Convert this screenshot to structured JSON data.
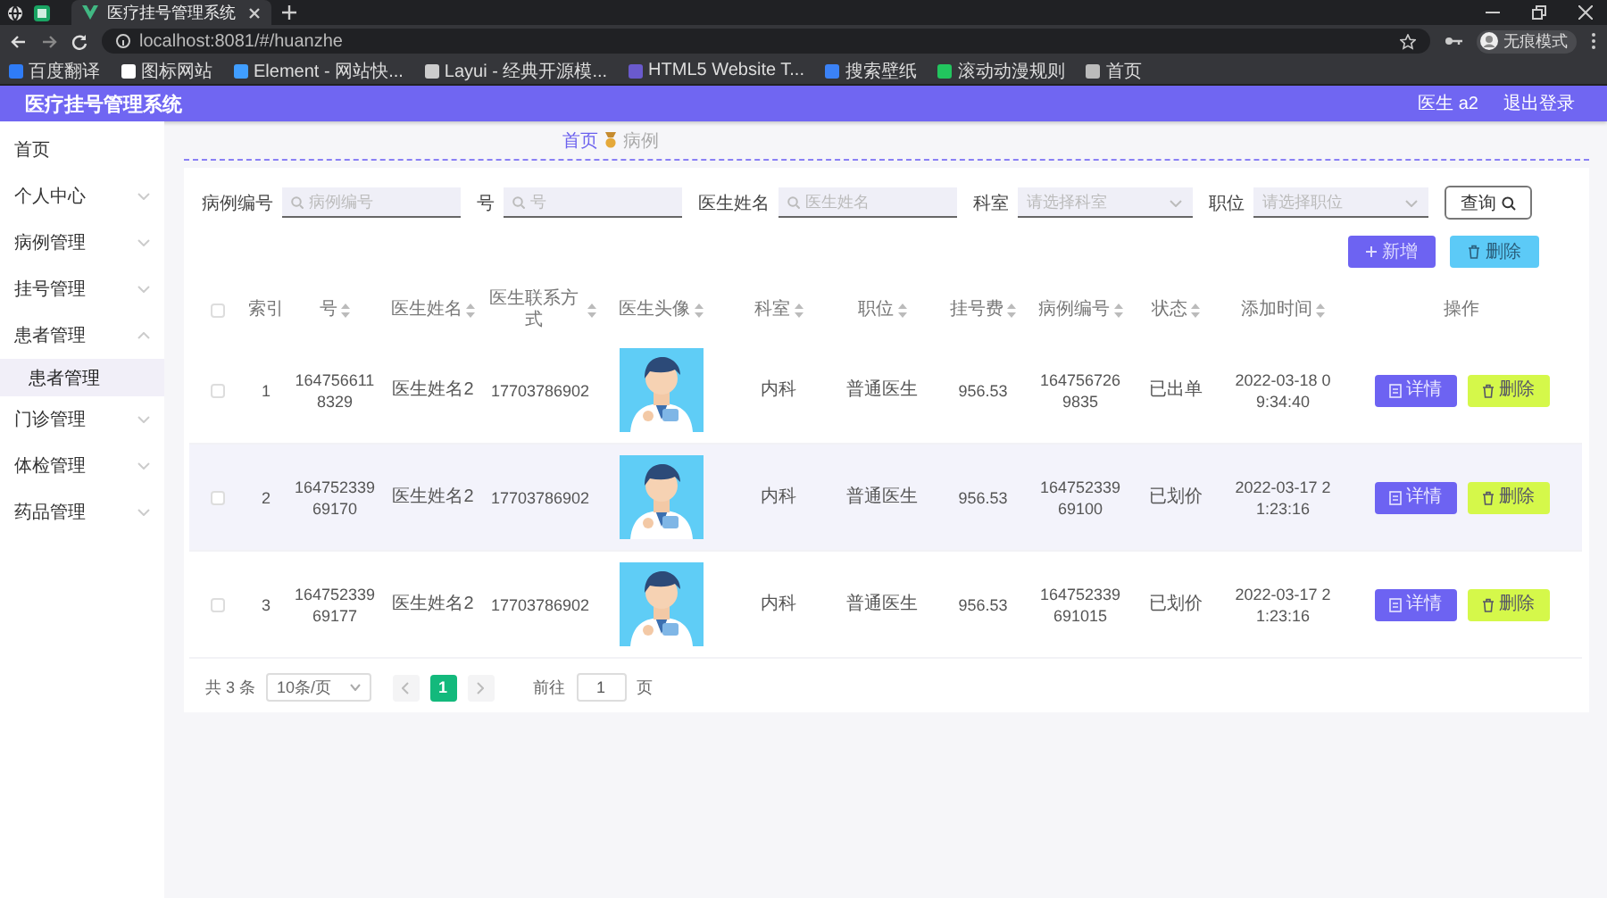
{
  "browser": {
    "tab_title": "医疗挂号管理系统",
    "url": "localhost:8081/#/huanzhe",
    "profile": "无痕模式",
    "bookmarks": [
      {
        "label": "百度翻译",
        "color": "#2f7cf6"
      },
      {
        "label": "图标网站",
        "color": "#ffffff"
      },
      {
        "label": "Element - 网站快...",
        "color": "#409eff"
      },
      {
        "label": "Layui - 经典开源模...",
        "color": "#cccccc"
      },
      {
        "label": "HTML5 Website T...",
        "color": "#6a5acd"
      },
      {
        "label": "搜索壁纸",
        "color": "#3b82f6"
      },
      {
        "label": "滚动动漫规则",
        "color": "#22c55e"
      },
      {
        "label": "首页",
        "color": "#bbbbbb"
      }
    ]
  },
  "app": {
    "title": "医疗挂号管理系统",
    "user": "医生 a2",
    "logout": "退出登录"
  },
  "sidebar": [
    {
      "label": "首页",
      "kind": "link"
    },
    {
      "label": "个人中心",
      "kind": "submenu",
      "expanded": false
    },
    {
      "label": "病例管理",
      "kind": "submenu",
      "expanded": false
    },
    {
      "label": "挂号管理",
      "kind": "submenu",
      "expanded": false
    },
    {
      "label": "患者管理",
      "kind": "submenu",
      "expanded": true,
      "children": [
        {
          "label": "患者管理",
          "selected": true
        }
      ]
    },
    {
      "label": "门诊管理",
      "kind": "submenu",
      "expanded": false
    },
    {
      "label": "体检管理",
      "kind": "submenu",
      "expanded": false
    },
    {
      "label": "药品管理",
      "kind": "submenu",
      "expanded": false
    }
  ],
  "breadcrumb": [
    "首页",
    "病例"
  ],
  "search": {
    "fields": [
      {
        "label": "病例编号",
        "placeholder": "病例编号",
        "kind": "text"
      },
      {
        "label": "号",
        "placeholder": "号",
        "kind": "text"
      },
      {
        "label": "医生姓名",
        "placeholder": "医生姓名",
        "kind": "text"
      },
      {
        "label": "科室",
        "placeholder": "请选择科室",
        "kind": "select"
      },
      {
        "label": "职位",
        "placeholder": "请选择职位",
        "kind": "select"
      }
    ],
    "button": "查询"
  },
  "actions": [
    {
      "label": "新增",
      "kind": "add"
    },
    {
      "label": "删除",
      "kind": "delete"
    }
  ],
  "table": {
    "all_checked": false,
    "columns": [
      {
        "label": "索引",
        "sortable": false
      },
      {
        "label": "号",
        "sortable": true
      },
      {
        "label": "医生姓名",
        "sortable": true
      },
      {
        "label": "医生联系方式",
        "sortable": true
      },
      {
        "label": "医生头像",
        "sortable": true
      },
      {
        "label": "科室",
        "sortable": true
      },
      {
        "label": "职位",
        "sortable": true
      },
      {
        "label": "挂号费",
        "sortable": true
      },
      {
        "label": "病例编号",
        "sortable": true
      },
      {
        "label": "状态",
        "sortable": true
      },
      {
        "label": "添加时间",
        "sortable": true
      },
      {
        "label": "操作",
        "sortable": false
      }
    ],
    "rows": [
      {
        "checked": false,
        "hovered": false,
        "cells": [
          "1",
          "1647566118329",
          "医生姓名2",
          "17703786902",
          {
            "kind": "picture"
          },
          "内科",
          "普通医生",
          "956.53",
          "1647567269835",
          "已出单",
          "2022-03-18 09:34:40"
        ],
        "buttons": [
          {
            "label": "详情",
            "kind": "detail"
          },
          {
            "label": "删除",
            "kind": "delete"
          }
        ]
      },
      {
        "checked": false,
        "hovered": true,
        "cells": [
          "2",
          "16475233969170",
          "医生姓名2",
          "17703786902",
          {
            "kind": "picture"
          },
          "内科",
          "普通医生",
          "956.53",
          "16475233969100",
          "已划价",
          "2022-03-17 21:23:16"
        ],
        "buttons": [
          {
            "label": "详情",
            "kind": "detail"
          },
          {
            "label": "删除",
            "kind": "delete"
          }
        ]
      },
      {
        "checked": false,
        "hovered": false,
        "cells": [
          "3",
          "16475233969177",
          "医生姓名2",
          "17703786902",
          {
            "kind": "picture"
          },
          "内科",
          "普通医生",
          "956.53",
          "164752339691015",
          "已划价",
          "2022-03-17 21:23:16"
        ],
        "buttons": [
          {
            "label": "详情",
            "kind": "detail"
          },
          {
            "label": "删除",
            "kind": "delete"
          }
        ]
      }
    ]
  },
  "pagination": {
    "total": "共 3 条",
    "page_size": "10条/页",
    "pages": [
      {
        "label": "1",
        "selected": true
      }
    ],
    "goto_label": "前往",
    "goto_value": "1",
    "goto_suffix": "页"
  }
}
